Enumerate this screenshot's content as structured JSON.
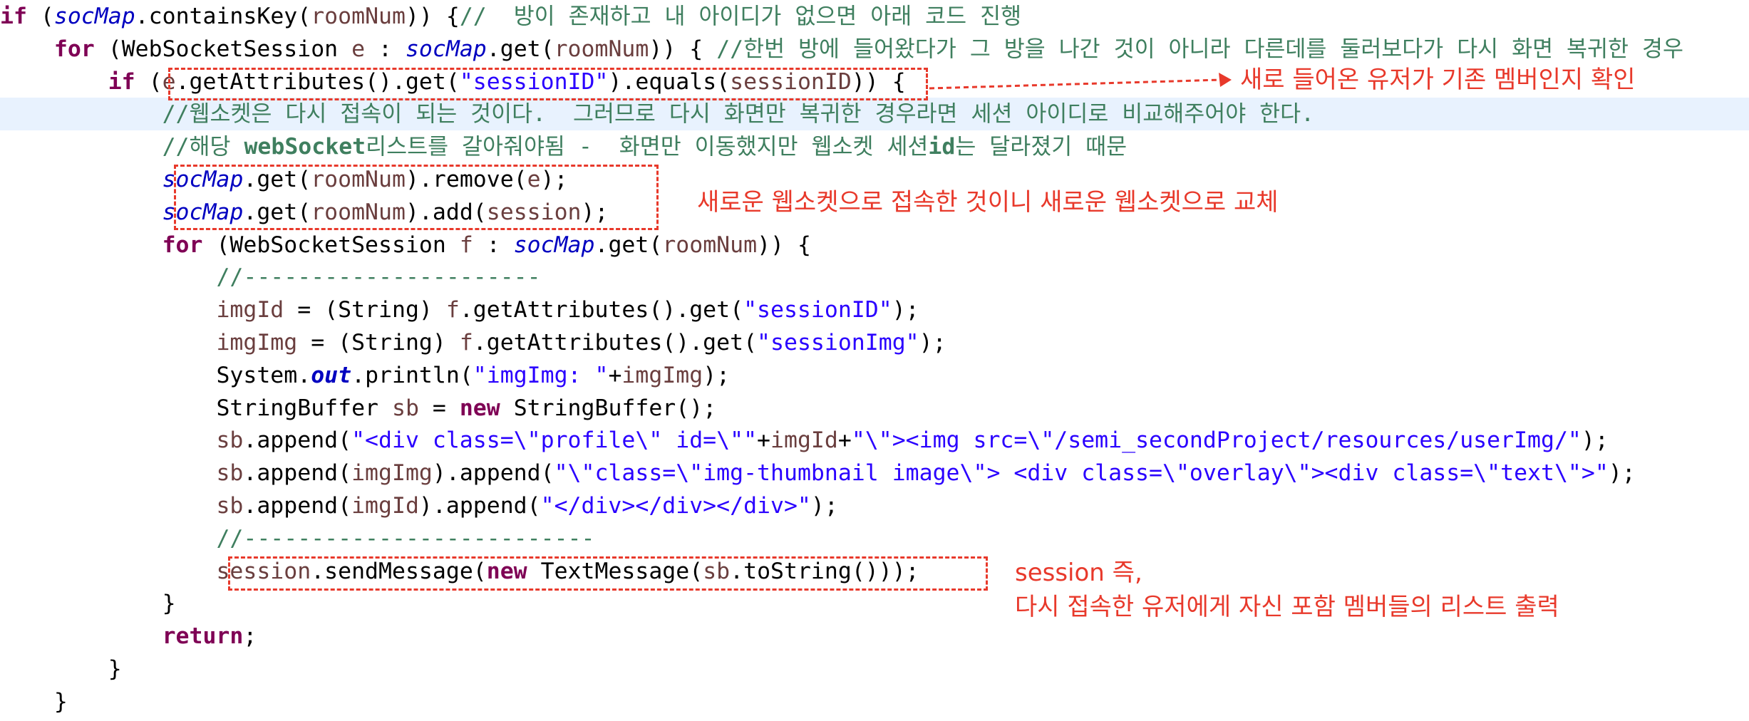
{
  "code": {
    "line1": {
      "indent": "",
      "parts": [
        {
          "t": "if",
          "c": "kw"
        },
        {
          "t": " (",
          "c": ""
        },
        {
          "t": "socMap",
          "c": "fld"
        },
        {
          "t": ".containsKey(",
          "c": ""
        },
        {
          "t": "roomNum",
          "c": "var"
        },
        {
          "t": ")) {",
          "c": ""
        },
        {
          "t": "//  방이 존재하고 내 아이디가 없으면 아래 코드 진행",
          "c": "cmt"
        }
      ]
    },
    "line2": {
      "indent": "    ",
      "parts": [
        {
          "t": "for",
          "c": "kw"
        },
        {
          "t": " (WebSocketSession ",
          "c": ""
        },
        {
          "t": "e",
          "c": "var"
        },
        {
          "t": " : ",
          "c": ""
        },
        {
          "t": "socMap",
          "c": "fld"
        },
        {
          "t": ".get(",
          "c": ""
        },
        {
          "t": "roomNum",
          "c": "var"
        },
        {
          "t": ")) { ",
          "c": ""
        },
        {
          "t": "//한번 방에 들어왔다가 그 방을 나간 것이 아니라 다른데를 둘러보다가 다시 화면 복귀한 경우",
          "c": "cmt"
        }
      ]
    },
    "line3": {
      "indent": "        ",
      "parts": [
        {
          "t": "if",
          "c": "kw"
        },
        {
          "t": " (",
          "c": ""
        },
        {
          "t": "e",
          "c": "var"
        },
        {
          "t": ".getAttributes().get(",
          "c": ""
        },
        {
          "t": "\"sessionID\"",
          "c": "str"
        },
        {
          "t": ").equals(",
          "c": ""
        },
        {
          "t": "sessionID",
          "c": "var"
        },
        {
          "t": ")) {",
          "c": ""
        }
      ]
    },
    "line4": {
      "indent": "            ",
      "parts": [
        {
          "t": "//웹소켓은 다시 접속이 되는 것이다.  그러므로 다시 화면만 복귀한 경우라면 세션 아이디로 비교해주어야 한다.",
          "c": "cmt"
        }
      ]
    },
    "line5": {
      "indent": "            ",
      "parts": [
        {
          "t": "//해당 ",
          "c": "cmt"
        },
        {
          "t": "webSocket",
          "c": "cmt b"
        },
        {
          "t": "리스트를 갈아줘야됨 -  화면만 이동했지만 웹소켓 세션",
          "c": "cmt"
        },
        {
          "t": "id",
          "c": "cmt b"
        },
        {
          "t": "는 달라졌기 때문",
          "c": "cmt"
        }
      ]
    },
    "line6": {
      "indent": "            ",
      "parts": [
        {
          "t": "socMap",
          "c": "fld"
        },
        {
          "t": ".get(",
          "c": ""
        },
        {
          "t": "roomNum",
          "c": "var"
        },
        {
          "t": ").remove(",
          "c": ""
        },
        {
          "t": "e",
          "c": "var"
        },
        {
          "t": ");",
          "c": ""
        }
      ]
    },
    "line7": {
      "indent": "            ",
      "parts": [
        {
          "t": "socMap",
          "c": "fld"
        },
        {
          "t": ".get(",
          "c": ""
        },
        {
          "t": "roomNum",
          "c": "var"
        },
        {
          "t": ").add(",
          "c": ""
        },
        {
          "t": "session",
          "c": "var"
        },
        {
          "t": ");",
          "c": ""
        }
      ]
    },
    "line8": {
      "indent": "            ",
      "parts": [
        {
          "t": "for",
          "c": "kw"
        },
        {
          "t": " (WebSocketSession ",
          "c": ""
        },
        {
          "t": "f",
          "c": "var"
        },
        {
          "t": " : ",
          "c": ""
        },
        {
          "t": "socMap",
          "c": "fld"
        },
        {
          "t": ".get(",
          "c": ""
        },
        {
          "t": "roomNum",
          "c": "var"
        },
        {
          "t": ")) {",
          "c": ""
        }
      ]
    },
    "line9": {
      "indent": "                ",
      "parts": [
        {
          "t": "//----------------------",
          "c": "cmt"
        }
      ]
    },
    "line10": {
      "indent": "                ",
      "parts": [
        {
          "t": "imgId",
          "c": "var"
        },
        {
          "t": " = (String) ",
          "c": ""
        },
        {
          "t": "f",
          "c": "var"
        },
        {
          "t": ".getAttributes().get(",
          "c": ""
        },
        {
          "t": "\"sessionID\"",
          "c": "str"
        },
        {
          "t": ");",
          "c": ""
        }
      ]
    },
    "line11": {
      "indent": "                ",
      "parts": [
        {
          "t": "imgImg",
          "c": "var"
        },
        {
          "t": " = (String) ",
          "c": ""
        },
        {
          "t": "f",
          "c": "var"
        },
        {
          "t": ".getAttributes().get(",
          "c": ""
        },
        {
          "t": "\"sessionImg\"",
          "c": "str"
        },
        {
          "t": ");",
          "c": ""
        }
      ]
    },
    "line12": {
      "indent": "                ",
      "parts": [
        {
          "t": "System.",
          "c": ""
        },
        {
          "t": "out",
          "c": "fld-b"
        },
        {
          "t": ".println(",
          "c": ""
        },
        {
          "t": "\"imgImg: \"",
          "c": "str"
        },
        {
          "t": "+",
          "c": ""
        },
        {
          "t": "imgImg",
          "c": "var"
        },
        {
          "t": ");",
          "c": ""
        }
      ]
    },
    "line13": {
      "indent": "                ",
      "parts": [
        {
          "t": "StringBuffer ",
          "c": ""
        },
        {
          "t": "sb",
          "c": "var"
        },
        {
          "t": " = ",
          "c": ""
        },
        {
          "t": "new",
          "c": "kw"
        },
        {
          "t": " StringBuffer();",
          "c": ""
        }
      ]
    },
    "line14": {
      "indent": "                ",
      "parts": [
        {
          "t": "sb",
          "c": "var"
        },
        {
          "t": ".append(",
          "c": ""
        },
        {
          "t": "\"<div class=\\\"profile\\\" id=\\\"\"",
          "c": "str"
        },
        {
          "t": "+",
          "c": ""
        },
        {
          "t": "imgId",
          "c": "var"
        },
        {
          "t": "+",
          "c": ""
        },
        {
          "t": "\"\\\"><img src=\\\"/semi_secondProject/resources/userImg/\"",
          "c": "str"
        },
        {
          "t": ");",
          "c": ""
        }
      ]
    },
    "line15": {
      "indent": "                ",
      "parts": [
        {
          "t": "sb",
          "c": "var"
        },
        {
          "t": ".append(",
          "c": ""
        },
        {
          "t": "imgImg",
          "c": "var"
        },
        {
          "t": ").append(",
          "c": ""
        },
        {
          "t": "\"\\\"class=\\\"img-thumbnail image\\\"> <div class=\\\"overlay\\\"><div class=\\\"text\\\">\"",
          "c": "str"
        },
        {
          "t": ");",
          "c": ""
        }
      ]
    },
    "line16": {
      "indent": "                ",
      "parts": [
        {
          "t": "sb",
          "c": "var"
        },
        {
          "t": ".append(",
          "c": ""
        },
        {
          "t": "imgId",
          "c": "var"
        },
        {
          "t": ").append(",
          "c": ""
        },
        {
          "t": "\"</div></div></div>\"",
          "c": "str"
        },
        {
          "t": ");",
          "c": ""
        }
      ]
    },
    "line17": {
      "indent": "                ",
      "parts": [
        {
          "t": "//--------------------------",
          "c": "cmt"
        }
      ]
    },
    "line18": {
      "indent": "                ",
      "parts": [
        {
          "t": "session",
          "c": "var"
        },
        {
          "t": ".sendMessage(",
          "c": ""
        },
        {
          "t": "new",
          "c": "kw"
        },
        {
          "t": " TextMessage(",
          "c": ""
        },
        {
          "t": "sb",
          "c": "var"
        },
        {
          "t": ".toString()));",
          "c": ""
        }
      ]
    },
    "line19": {
      "indent": "            ",
      "parts": [
        {
          "t": "}",
          "c": ""
        }
      ]
    },
    "line20": {
      "indent": "            ",
      "parts": [
        {
          "t": "return",
          "c": "kw"
        },
        {
          "t": ";",
          "c": ""
        }
      ]
    },
    "line21": {
      "indent": "        ",
      "parts": [
        {
          "t": "}",
          "c": ""
        }
      ]
    },
    "line22": {
      "indent": "    ",
      "parts": [
        {
          "t": "}",
          "c": ""
        }
      ]
    }
  },
  "annotations": {
    "member_check": "새로 들어온 유저가 기존 멤버인지 확인",
    "replace_socket": "새로운 웹소켓으로 접속한 것이니 새로운 웹소켓으로 교체",
    "session_side_1": "session 즉,",
    "session_side_2": "다시 접속한 유저에게 자신 포함 멤버들의 리스트 출력"
  },
  "colors": {
    "keyword": "#7f0055",
    "field": "#0000c0",
    "string": "#2a00ff",
    "comment": "#3f7f5f",
    "variable": "#6a3e3e",
    "annotation": "#e8392b",
    "highlight_line": "#e8f2fe"
  }
}
